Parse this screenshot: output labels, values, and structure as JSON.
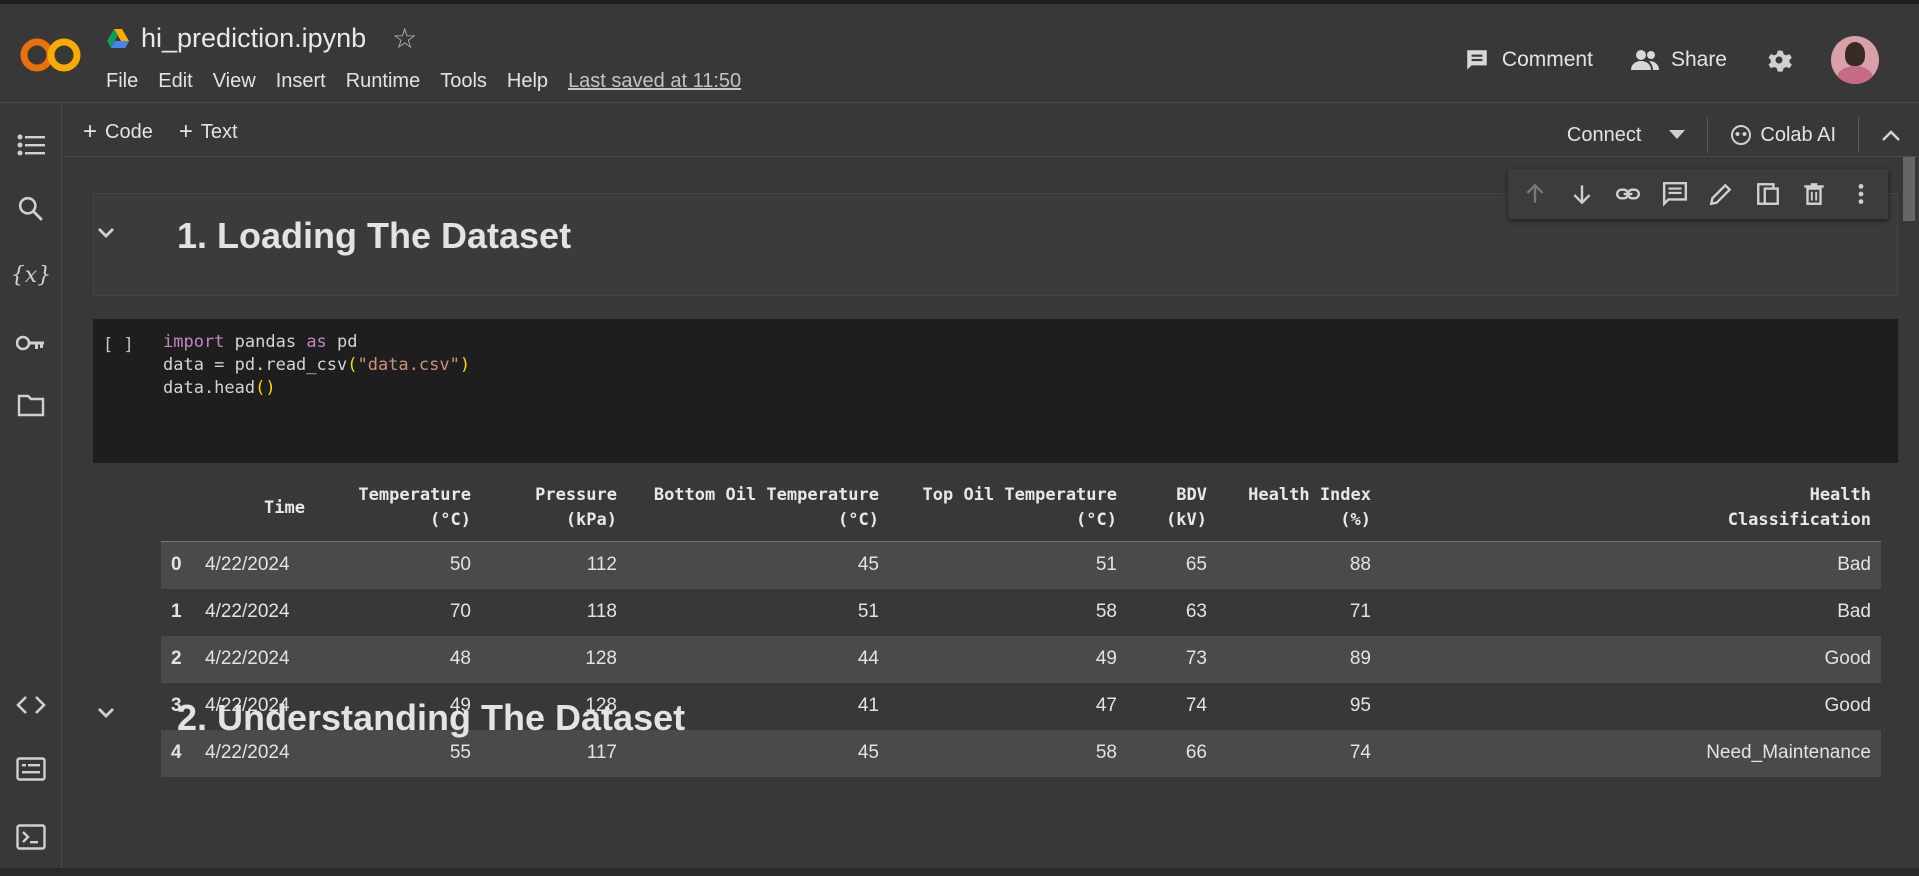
{
  "app": {
    "logo": "CO",
    "notebook_title": "hi_prediction.ipynb",
    "menu": [
      "File",
      "Edit",
      "View",
      "Insert",
      "Runtime",
      "Tools",
      "Help"
    ],
    "last_saved": "Last saved at 11:50",
    "comment_label": "Comment",
    "share_label": "Share"
  },
  "toolbar": {
    "add_code": "Code",
    "add_text": "Text",
    "connect_label": "Connect",
    "colab_ai_label": "Colab AI"
  },
  "cells": {
    "heading1": "1. Loading The Dataset",
    "run_indicator": "[ ]",
    "heading2": "2. Understanding The Dataset"
  },
  "table": {
    "columns": [
      "",
      "Time",
      "Temperature\n(°C)",
      "Pressure\n(kPa)",
      "Bottom Oil Temperature\n(°C)",
      "Top Oil Temperature\n(°C)",
      "BDV\n(kV)",
      "Health Index\n(%)",
      "Health\nClassification"
    ],
    "rows": [
      [
        "0",
        "4/22/2024",
        "50",
        "112",
        "45",
        "51",
        "65",
        "88",
        "Bad"
      ],
      [
        "1",
        "4/22/2024",
        "70",
        "118",
        "51",
        "58",
        "63",
        "71",
        "Bad"
      ],
      [
        "2",
        "4/22/2024",
        "48",
        "128",
        "44",
        "49",
        "73",
        "89",
        "Good"
      ],
      [
        "3",
        "4/22/2024",
        "49",
        "128",
        "41",
        "47",
        "74",
        "95",
        "Good"
      ],
      [
        "4",
        "4/22/2024",
        "55",
        "117",
        "45",
        "58",
        "66",
        "74",
        "Need_Maintenance"
      ]
    ]
  },
  "colors": {
    "background": "#383838",
    "code_bg": "#1e1e1e",
    "keyword": "#c586c0",
    "string": "#ce9178",
    "logo_orange": "#f9ab00"
  }
}
